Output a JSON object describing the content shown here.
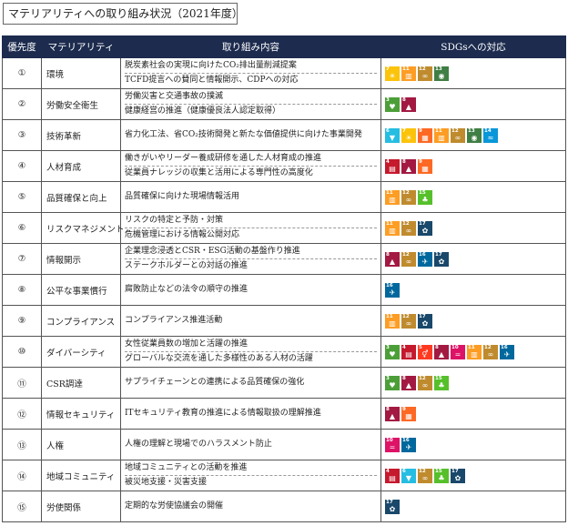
{
  "title": "マテリアリティへの取り組み状況（2021年度）",
  "headers": {
    "priority": "優先度",
    "materiality": "マテリアリティ",
    "actions": "取り組み内容",
    "sdgs": "SDGsへの対応"
  },
  "sdg_colors": {
    "3": "#4c9f38",
    "4": "#c5192d",
    "5": "#ff3a21",
    "6": "#26bde2",
    "7": "#fcc30b",
    "8": "#a21942",
    "9": "#fd6925",
    "10": "#dd1367",
    "11": "#fd9d24",
    "12": "#bf8b2e",
    "13": "#3f7e44",
    "14": "#0a97d9",
    "15": "#56c02b",
    "16": "#00689d",
    "17": "#19486a"
  },
  "sdg_icons": {
    "3": "heartbeat-icon",
    "4": "book-icon",
    "5": "gender-icon",
    "6": "water-drop-icon",
    "7": "sun-icon",
    "8": "growth-chart-icon",
    "9": "cubes-icon",
    "10": "equality-icon",
    "11": "city-icon",
    "12": "infinity-icon",
    "13": "eye-globe-icon",
    "14": "fish-icon",
    "15": "tree-icon",
    "16": "dove-icon",
    "17": "flower-ring-icon"
  },
  "sdg_glyphs": {
    "3": "♥",
    "4": "▤",
    "5": "⚥",
    "6": "▼",
    "7": "☀",
    "8": "▲",
    "9": "▦",
    "10": "=",
    "11": "▥",
    "12": "∞",
    "13": "◉",
    "14": "≈",
    "15": "♣",
    "16": "✈",
    "17": "✿"
  },
  "rows": [
    {
      "no": "①",
      "name": "環境",
      "actions": [
        "脱炭素社会の実現に向けたCO₂排出量削減提案",
        "TCFD提言への賛同と情報開示、CDPへの対応"
      ],
      "sdgs": [
        "7",
        "11",
        "12",
        "13"
      ]
    },
    {
      "no": "②",
      "name": "労働安全衛生",
      "actions": [
        "労働災害と交通事故の撲滅",
        "健康経営の推進（健康優良法人認定取得）"
      ],
      "sdgs": [
        "3",
        "8"
      ]
    },
    {
      "no": "③",
      "name": "技術革新",
      "actions": [
        "省力化工法、省CO₂技術開発と新たな価値提供に向けた事業開発"
      ],
      "sdgs": [
        "6",
        "7",
        "9",
        "11",
        "12",
        "13",
        "14"
      ]
    },
    {
      "no": "④",
      "name": "人材育成",
      "actions": [
        "働きがいやリーダー養成研修を通した人材育成の推進",
        "従業員ナレッジの収集と活用による専門性の高度化"
      ],
      "sdgs": [
        "4",
        "8",
        "9"
      ]
    },
    {
      "no": "⑤",
      "name": "品質確保と向上",
      "actions": [
        "品質確保に向けた現場情報活用"
      ],
      "sdgs": [
        "11",
        "12",
        "15"
      ]
    },
    {
      "no": "⑥",
      "name": "リスクマネジメント",
      "actions": [
        "リスクの特定と予防・対策",
        "危機管理における情報公開対応"
      ],
      "sdgs": [
        "11",
        "12",
        "17"
      ]
    },
    {
      "no": "⑦",
      "name": "情報開示",
      "actions": [
        "企業理念浸透とCSR・ESG活動の基盤作り推進",
        "ステークホルダーとの対話の推進"
      ],
      "sdgs": [
        "8",
        "12",
        "16",
        "17"
      ]
    },
    {
      "no": "⑧",
      "name": "公平な事業慣行",
      "actions": [
        "腐敗防止などの法令の順守の推進"
      ],
      "sdgs": [
        "16"
      ]
    },
    {
      "no": "⑨",
      "name": "コンプライアンス",
      "actions": [
        "コンプライアンス推進活動"
      ],
      "sdgs": [
        "11",
        "12",
        "17"
      ]
    },
    {
      "no": "⑩",
      "name": "ダイバーシティ",
      "actions": [
        "女性従業員数の増加と活躍の推進",
        "グローバルな交流を通した多様性のある人材の活躍"
      ],
      "sdgs": [
        "3",
        "4",
        "5",
        "8",
        "10",
        "11",
        "12",
        "16"
      ]
    },
    {
      "no": "⑪",
      "name": "CSR調達",
      "actions": [
        "サプライチェーンとの連携による品質確保の強化"
      ],
      "sdgs": [
        "3",
        "8",
        "12",
        "15"
      ]
    },
    {
      "no": "⑫",
      "name": "情報セキュリティ",
      "actions": [
        "ITセキュリティ教育の推進による情報取扱の理解推進"
      ],
      "sdgs": [
        "8",
        "9"
      ]
    },
    {
      "no": "⑬",
      "name": "人権",
      "actions": [
        "人権の理解と現場でのハラスメント防止"
      ],
      "sdgs": [
        "10",
        "16"
      ]
    },
    {
      "no": "⑭",
      "name": "地域コミュニティ",
      "actions": [
        "地域コミュニティとの活動を推進",
        "被災地支援・災害支援"
      ],
      "sdgs": [
        "4",
        "6",
        "12",
        "15",
        "17"
      ]
    },
    {
      "no": "⑮",
      "name": "労使関係",
      "actions": [
        "定期的な労使協議会の開催"
      ],
      "sdgs": [
        "17"
      ]
    }
  ]
}
